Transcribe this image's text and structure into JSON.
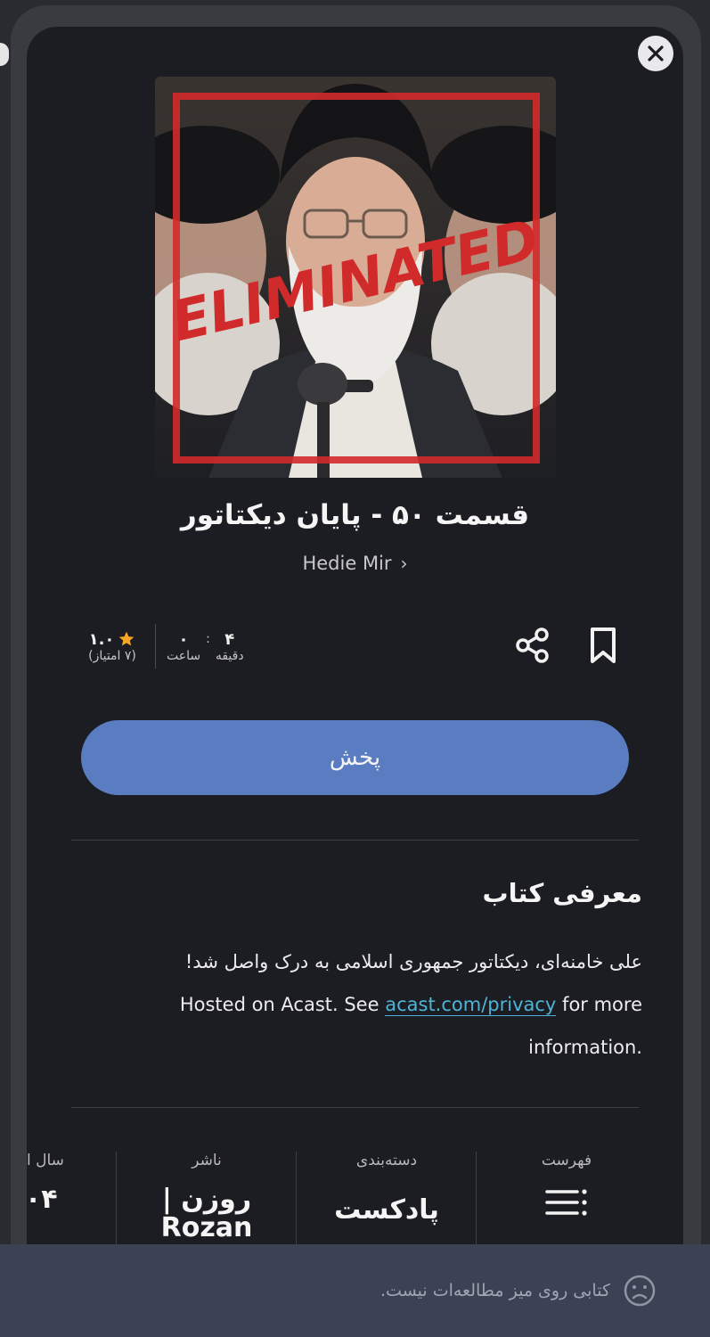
{
  "episode": {
    "title": "قسمت ۵۰ - پایان دیکتاتور",
    "author": "Hedie Mir",
    "cover_text": "ELIMINATED"
  },
  "stats": {
    "rating_value": "۱.۰",
    "rating_count": "(۷ امتیاز)",
    "hours_value": "۰",
    "hours_label": "ساعت",
    "colon": ":",
    "minutes_value": "۴",
    "minutes_label": "دقیقه"
  },
  "actions": {
    "play_label": "پخش",
    "share_icon": "share-icon",
    "bookmark_icon": "bookmark-icon"
  },
  "intro": {
    "heading": "معرفی کتاب",
    "line1": "علی خامنه‌ای، دیکتاتور جمهوری اسلامی به درک واصل شد!",
    "line2_prefix": "Hosted on Acast. See",
    "link_text": "acast.com/privacy",
    "line2_suffix": "for more",
    "line3": "information."
  },
  "meta": {
    "toc_label": "فهرست",
    "category_label": "دسته‌بندی",
    "category_value": "پادکست",
    "publisher_label": "ناشر",
    "publisher_value_fa": "روزن |",
    "publisher_value_en": "Rozan",
    "year_label": "سال ا",
    "year_value": "۰۴"
  },
  "bottom": {
    "message": "کتابی روی میز مطالعه‌ات نیست."
  },
  "colors": {
    "accent": "#5a7cc0",
    "link": "#4fb4d6",
    "star": "#f5a623",
    "cover_red": "#d12a2a"
  }
}
